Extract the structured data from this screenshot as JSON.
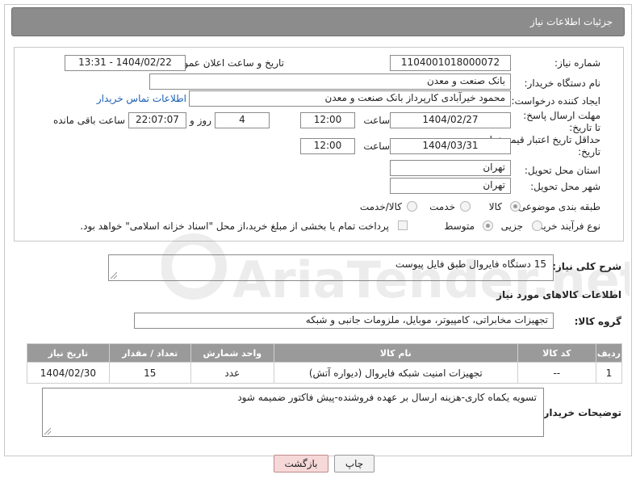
{
  "header": {
    "title": "جزئیات اطلاعات نیاز"
  },
  "form": {
    "need_number": {
      "label": "شماره نیاز:",
      "value": "1104001018000072"
    },
    "announce_datetime": {
      "label": "تاریخ و ساعت اعلان عمومی:",
      "value": "1404/02/22 - 13:31"
    },
    "buyer_org": {
      "label": "نام دستگاه خریدار:",
      "value": "بانک صنعت و معدن"
    },
    "requester": {
      "label": "ایجاد کننده درخواست:",
      "value": "محمود خیرآبادی کارپرداز بانک صنعت و معدن",
      "contact_link": "اطلاعات تماس خریدار"
    },
    "reply_deadline": {
      "label": "مهلت ارسال پاسخ: تا تاریخ:",
      "date": "1404/02/27",
      "time_label": "ساعت",
      "time": "12:00",
      "days": "4",
      "days_label": "روز و",
      "remaining": "22:07:07",
      "remaining_label": "ساعت باقی مانده"
    },
    "price_validity": {
      "label": "حداقل تاریخ اعتبار قیمت: تا تاریخ:",
      "date": "1404/03/31",
      "time_label": "ساعت",
      "time": "12:00"
    },
    "delivery_province": {
      "label": "استان محل تحویل:",
      "value": "تهران"
    },
    "delivery_city": {
      "label": "شهر محل تحویل:",
      "value": "تهران"
    },
    "category": {
      "label": "طبقه بندی موضوعی:",
      "options": [
        "کالا",
        "خدمت",
        "کالا/خدمت"
      ],
      "selected": "کالا"
    },
    "purchase_process": {
      "label": "نوع فرآیند خرید :",
      "options": [
        "جزیی",
        "متوسط"
      ],
      "selected": "متوسط",
      "note": "پرداخت تمام یا بخشی از مبلغ خرید،از محل \"اسناد خزانه اسلامی\" خواهد بود."
    }
  },
  "summary": {
    "label": "شرح کلی نیاز:",
    "value": "15 دستگاه فایروال طبق فایل پیوست"
  },
  "goods_section": {
    "title": "اطلاعات کالاهای مورد نیاز",
    "group_label": "گروه کالا:",
    "group_value": "تجهیزات مخابراتی، کامپیوتر، موبایل، ملزومات جانبی و شبکه",
    "columns": [
      "ردیف",
      "کد کالا",
      "نام کالا",
      "واحد شمارش",
      "تعداد / مقدار",
      "تاریخ نیاز"
    ],
    "rows": [
      [
        "1",
        "--",
        "تجهیزات امنیت شبکه فایروال (دیواره آتش)",
        "عدد",
        "15",
        "1404/02/30"
      ]
    ]
  },
  "buyer_notes": {
    "label": "توضیحات خریدار:",
    "value": "تسویه یکماه کاری-هزینه ارسال بر عهده فروشنده-پیش فاکتور ضمیمه شود"
  },
  "buttons": {
    "print": "چاپ",
    "back": "بازگشت"
  },
  "watermark": {
    "text": "AriaTender.net"
  }
}
